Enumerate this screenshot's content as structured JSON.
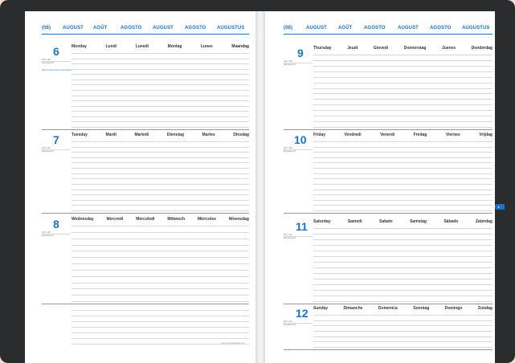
{
  "left_header": [
    "(08)",
    "AUGUST",
    "AOÛT",
    "AGOSTO",
    "AUGUST",
    "AGOSTO",
    "AUGUSTUS"
  ],
  "right_header": [
    "(08)",
    "AUGUST",
    "AOÛT",
    "AGOSTO",
    "AUGUST",
    "AGOSTO",
    "AUGUSTUS"
  ],
  "days": [
    {
      "num": "6",
      "names": [
        "Monday",
        "Lundi",
        "Lunedì",
        "Montag",
        "Lunes",
        "Maandag"
      ],
      "sub1": "219 / 146",
      "sub2": "Dominical 47",
      "note": "(Day of Assumption Anniversary)"
    },
    {
      "num": "7",
      "names": [
        "Tuesday",
        "Mardi",
        "Martedì",
        "Dienstag",
        "Martes",
        "Dinsdag"
      ],
      "sub1": "219 / 146",
      "sub2": "Dominical 47"
    },
    {
      "num": "8",
      "names": [
        "Wednesday",
        "Mercredi",
        "Mercoledì",
        "Mittwoch",
        "Miércoles",
        "Woensdag"
      ],
      "sub1": "220 / 145",
      "sub2": "Dominical 47"
    },
    {
      "num": "9",
      "names": [
        "Thursday",
        "Jeudi",
        "Giovedì",
        "Donnerstag",
        "Jueves",
        "Donderdag"
      ],
      "sub1": "221 / 144",
      "sub2": "Dominical 47"
    },
    {
      "num": "10",
      "names": [
        "Friday",
        "Vendredi",
        "Venerdì",
        "Freitag",
        "Viernes",
        "Vrijdag"
      ],
      "sub1": "222 / 143",
      "sub2": "Dominical 47"
    },
    {
      "num": "11",
      "names": [
        "Saturday",
        "Samedi",
        "Sabato",
        "Samstag",
        "Sábado",
        "Zaterdag"
      ],
      "sub1": "223 / 142",
      "sub2": "Dominical 47"
    },
    {
      "num": "12",
      "names": [
        "Sunday",
        "Dimanche",
        "Domenica",
        "Sonntag",
        "Domingo",
        "Zondag"
      ],
      "sub1": "224 / 141",
      "sub2": "Dominical 47"
    }
  ],
  "footer": "www.quovadisdiaries.com",
  "colors": {
    "accent": "#1a73c4",
    "cover": "#2b2c2e",
    "page": "#ffffff"
  }
}
